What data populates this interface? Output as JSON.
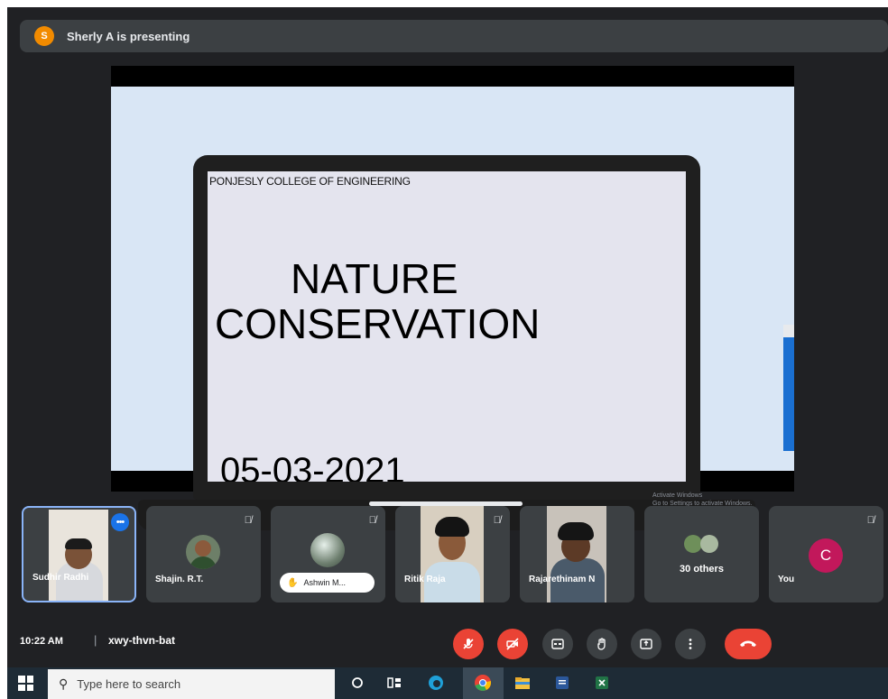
{
  "presenter": {
    "avatar_letter": "S",
    "label": "Sherly A is presenting",
    "avatar_color": "#f28b00"
  },
  "slide": {
    "college": "PONJESLY COLLEGE OF ENGINEERING",
    "title_line1": "NATURE",
    "title_line2": "CONSERVATION",
    "date": "05-03-2021",
    "watermark_line1": "Activate Windows",
    "watermark_line2": "Go to Settings to activate Windows."
  },
  "participants": [
    {
      "name": "Sudhir Radhi",
      "active": true
    },
    {
      "name": "Shajin. R.T.",
      "muted": true
    },
    {
      "name": "Ashwin M...",
      "muted": true
    },
    {
      "name": "Ritik Raja",
      "muted": true
    },
    {
      "name": "Rajarethinam N"
    },
    {
      "label": "30 others"
    },
    {
      "name": "You",
      "avatar_letter": "C",
      "muted": true
    }
  ],
  "meeting": {
    "time": "10:22 AM",
    "separator": "|",
    "code": "xwy-thvn-bat"
  },
  "controls": [
    "mic-off",
    "camera-off",
    "captions",
    "raise-hand",
    "present",
    "more",
    "end-call"
  ],
  "taskbar": {
    "search_placeholder": "Type here to search"
  },
  "colors": {
    "accent": "#1a73e8",
    "danger": "#ea4335",
    "background": "#202124",
    "tile": "#3c4043"
  }
}
